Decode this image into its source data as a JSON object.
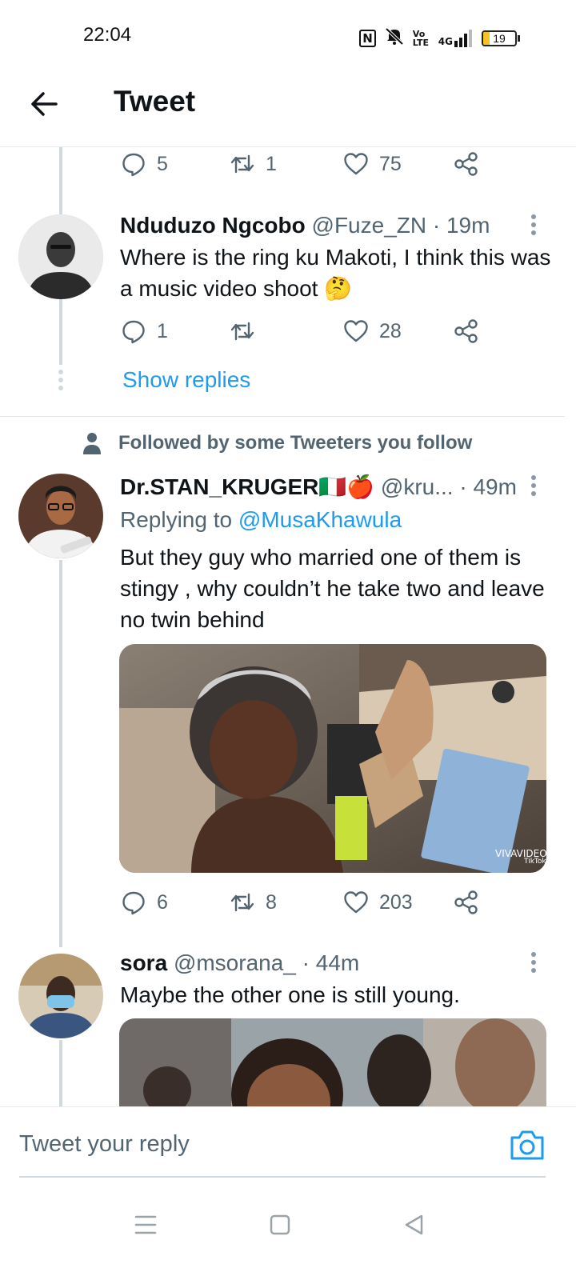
{
  "status_bar": {
    "time": "22:04",
    "icons": [
      "nfc-icon",
      "mute-icon",
      "volte-icon",
      "signal-4g-icon"
    ],
    "volte_label": "Vo LTE",
    "network_label": "4G",
    "battery_level": "19",
    "battery_accent": "#f4c222"
  },
  "header": {
    "title": "Tweet"
  },
  "colors": {
    "link": "#1d9bf0",
    "secondary_text": "#536471",
    "thread_line": "#cfd9de"
  },
  "tweets": [
    {
      "actions": {
        "replies": "5",
        "retweets": "1",
        "likes": "75"
      }
    },
    {
      "name": "Nduduzo Ngcobo",
      "handle": "@Fuze_ZN",
      "separator": "·",
      "time": "19m",
      "text": "Where is the ring ku Makoti, I think this was a music video shoot 🤔",
      "actions": {
        "replies": "1",
        "retweets": "",
        "likes": "28"
      }
    },
    {
      "social_context": "Followed by some Tweeters you follow",
      "name": "Dr.STAN_KRUGER🇮🇹🍎",
      "handle": "@kru...",
      "separator": "·",
      "time": "49m",
      "replying_prefix": "Replying to",
      "replying_to": "@MusaKhawula",
      "text": "But they guy who married one of them is stingy , why couldn’t he take two and leave no twin behind",
      "media_watermark": "VIVAVIDEO",
      "media_watermark_2": "TikTok",
      "actions": {
        "replies": "6",
        "retweets": "8",
        "likes": "203"
      }
    },
    {
      "name": "sora",
      "handle": "@msorana_",
      "separator": "·",
      "time": "44m",
      "text": "Maybe the other one is still young."
    }
  ],
  "thread": {
    "show_replies": "Show replies"
  },
  "composer": {
    "placeholder": "Tweet your reply"
  }
}
